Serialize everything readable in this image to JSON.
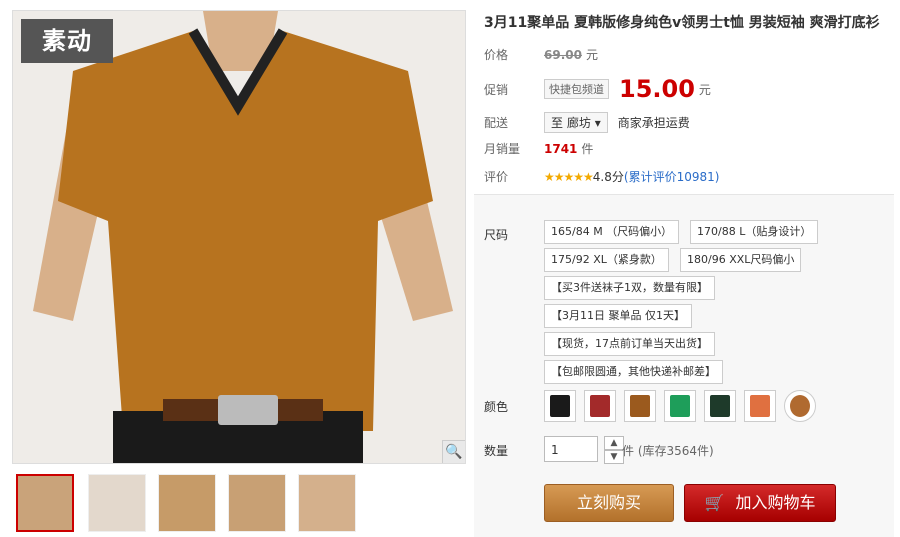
{
  "product": {
    "title": "3月11聚单品 夏韩版修身纯色v领男士t恤 男装短袖 爽滑打底衫",
    "logo_text": "素动"
  },
  "gallery": {
    "thumbnails_count": 5,
    "active_index": 0
  },
  "info": {
    "price_label": "价格",
    "old_price": "69.00",
    "unit": "元",
    "promo_label": "促销",
    "promo_channel": "快捷包频道",
    "current_price": "15.00",
    "shipping_label": "配送",
    "shipping_to": "至",
    "city": "廊坊",
    "shipping_note": "商家承担运费",
    "monthly_sales_label": "月销量",
    "monthly_sales": "1741",
    "sales_unit": "件",
    "rating_label": "评价",
    "stars": "★★★★★",
    "rating_score": "4.8分",
    "rating_total": "(累计评价10981)"
  },
  "options": {
    "size_label": "尺码",
    "sizes": [
      "165/84 M （尺码偏小）",
      "170/88 L（贴身设计）",
      "175/92 XL（紧身款）",
      "180/96 XXL尺码偏小",
      "【买3件送袜子1双，数量有限】",
      "【3月11日 聚单品 仅1天】",
      "【现货，17点前订单当天出货】",
      "【包邮限圆通，其他快递补邮差】"
    ],
    "color_label": "颜色",
    "colors": [
      "#1a1a1a",
      "#a32a2a",
      "#9b5a1e",
      "#1e9e5a",
      "#1e3a2a",
      "#e07040",
      "#b06a30"
    ],
    "qty_label": "数量",
    "qty_value": "1",
    "stock_text": "件 (库存3564件)"
  },
  "actions": {
    "buy_now": "立刻购买",
    "add_to_cart": "加入购物车"
  }
}
